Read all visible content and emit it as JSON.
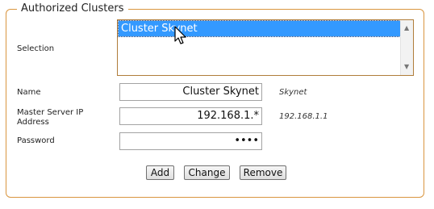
{
  "group": {
    "legend": "Authorized Clusters"
  },
  "selection": {
    "label": "Selection",
    "items": [
      "Cluster Skynet"
    ],
    "selected_index": 0
  },
  "name": {
    "label": "Name",
    "value": "Cluster Skynet",
    "hint": "Skynet"
  },
  "master_ip": {
    "label_line1": "Master Server IP",
    "label_line2": "Address",
    "value": "192.168.1.*",
    "hint": "192.168.1.1"
  },
  "password": {
    "label": "Password",
    "value": "••••"
  },
  "buttons": {
    "add": "Add",
    "change": "Change",
    "remove": "Remove"
  },
  "icons": {
    "scroll_up": "scroll-up-arrow-icon",
    "scroll_down": "scroll-down-arrow-icon",
    "cursor": "mouse-pointer-icon"
  },
  "colors": {
    "border_accent": "#d9953f",
    "selection": "#3399ff"
  }
}
